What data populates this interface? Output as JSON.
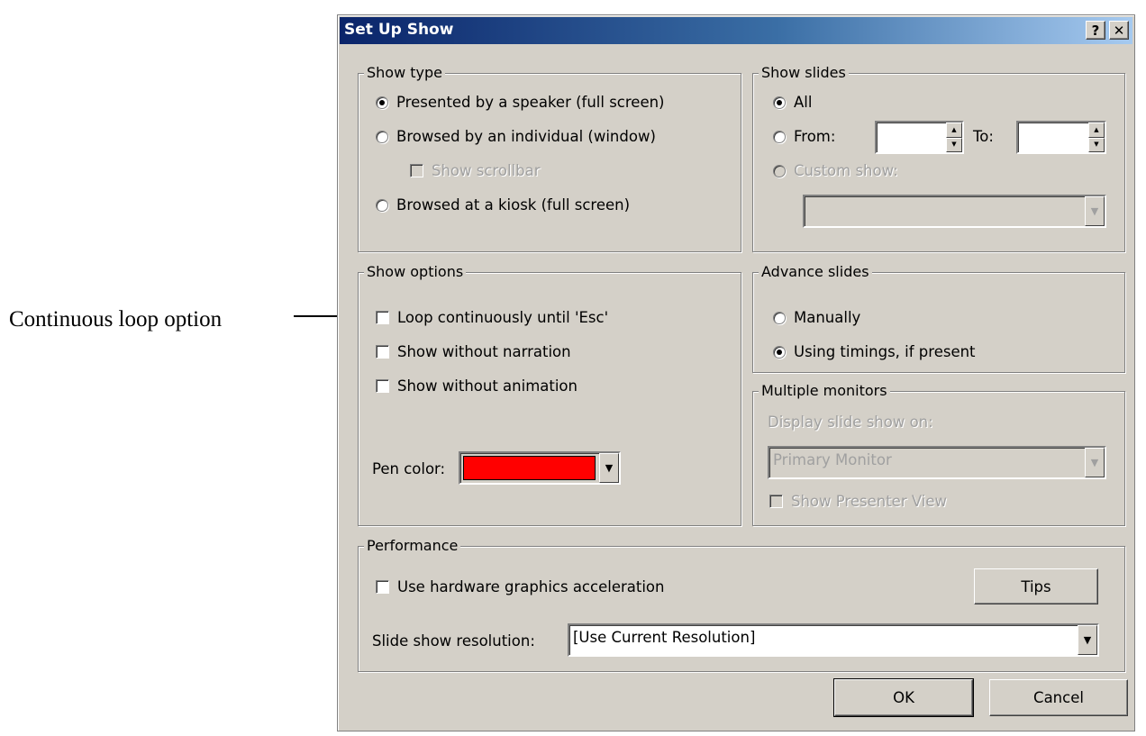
{
  "annotation": {
    "callout": "Continuous loop option"
  },
  "dialog": {
    "title": "Set Up Show",
    "help_button": "?",
    "close_button": "✕"
  },
  "show_type": {
    "label": "Show type",
    "options": [
      {
        "label": "Presented by a speaker (full screen)",
        "checked": true
      },
      {
        "label": "Browsed by an individual (window)",
        "checked": false
      },
      {
        "label": "Browsed at a kiosk (full screen)",
        "checked": false
      }
    ],
    "show_scrollbar": "Show scrollbar"
  },
  "show_slides": {
    "label": "Show slides",
    "all": "All",
    "from": "From:",
    "to": "To:",
    "custom_show": "Custom show:"
  },
  "show_options": {
    "label": "Show options",
    "loop": "Loop continuously until 'Esc'",
    "no_narration": "Show without narration",
    "no_animation": "Show without animation",
    "pen_color_label": "Pen color:",
    "pen_color": "#ff0000"
  },
  "advance_slides": {
    "label": "Advance slides",
    "manually": "Manually",
    "timings": "Using timings, if present",
    "selected": "timings"
  },
  "multiple_monitors": {
    "label": "Multiple monitors",
    "display_on": "Display slide show on:",
    "monitor": "Primary Monitor",
    "presenter_view": "Show Presenter View"
  },
  "performance": {
    "label": "Performance",
    "hw_accel": "Use hardware graphics acceleration",
    "tips": "Tips",
    "resolution_label": "Slide show resolution:",
    "resolution_value": "[Use Current Resolution]"
  },
  "footer": {
    "ok": "OK",
    "cancel": "Cancel"
  },
  "icons": {
    "dropdown": "▼",
    "spin_up": "▲",
    "spin_down": "▼"
  }
}
